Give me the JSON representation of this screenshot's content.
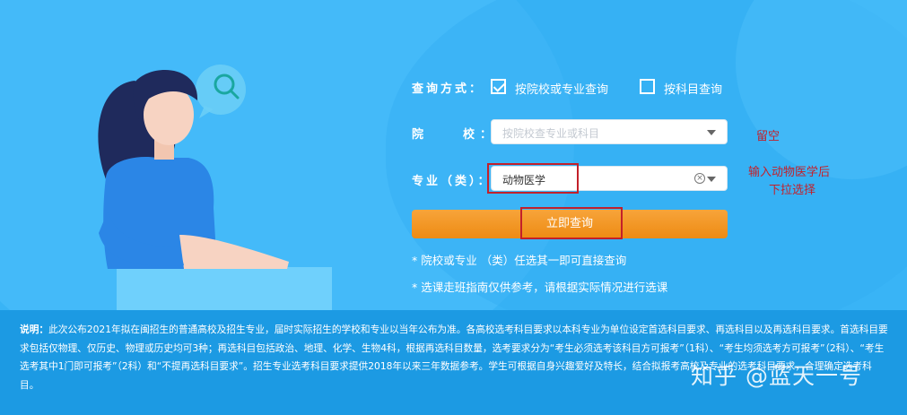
{
  "form": {
    "query_mode_label": "查询方式：",
    "option_school_major": "按院校或专业查询",
    "option_school_major_checked": true,
    "option_subject": "按科目查询",
    "option_subject_checked": false,
    "school_label": "院　　校：",
    "school_placeholder": "按院校查专业或科目",
    "major_label": "专业（类）：",
    "major_value": "动物医学",
    "submit_label": "立即查询",
    "hints": [
      "* 院校或专业 （类）任选其一即可直接查询",
      "* 选课走班指南仅供参考，请根据实际情况进行选课"
    ]
  },
  "annotations": {
    "leave_blank": "留空",
    "select_hint_line1": "输入动物医学后",
    "select_hint_line2": "下拉选择"
  },
  "note": {
    "title": "说明：",
    "text": "此次公布2021年拟在闽招生的普通高校及招生专业，届时实际招生的学校和专业以当年公布为准。各高校选考科目要求以本科专业为单位设定首选科目要求、再选科目以及再选科目要求。首选科目要求包括仅物理、仅历史、物理或历史均可3种；再选科目包括政治、地理、化学、生物4科，根据再选科目数量，选考要求分为“考生必须选考该科目方可报考”（1科）、“考生均须选考方可报考”（2科）、“考生选考其中1门即可报考”（2科）和“不提再选科目要求”。招生专业选考科目要求提供2018年以来三年数据参考。学生可根据自身兴趣爱好及特长，结合拟报考高校及专业的选考科目要求，合理确定选考科目。"
  },
  "watermark": "知乎 @蓝天一号",
  "colors": {
    "background": "#39b4f6",
    "note_bg": "#1c9ae3",
    "button": "#ee8b13",
    "annotation": "#c3202a"
  }
}
